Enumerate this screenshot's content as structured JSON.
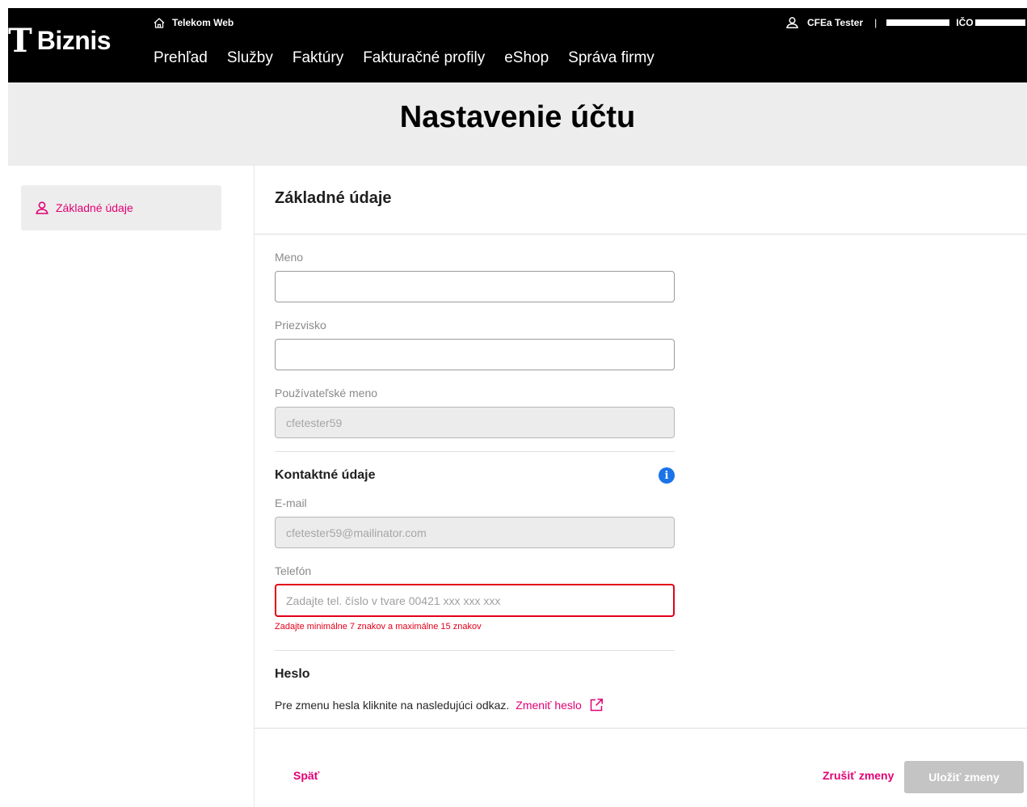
{
  "header": {
    "logo_mark": "T",
    "logo_text": "Biznis",
    "home_label": "Telekom Web",
    "nav": [
      {
        "label": "Prehľad"
      },
      {
        "label": "Služby"
      },
      {
        "label": "Faktúry"
      },
      {
        "label": "Fakturačné profily"
      },
      {
        "label": "eShop"
      },
      {
        "label": "Správa firmy"
      }
    ],
    "user_name": "CFEa Tester",
    "separator": "|",
    "ico_label": "IČO"
  },
  "page_title": "Nastavenie účtu",
  "sidebar": {
    "items": [
      {
        "label": "Základné údaje",
        "icon": "user-icon",
        "active": true
      }
    ]
  },
  "form": {
    "section_title": "Základné údaje",
    "first_name": {
      "label": "Meno",
      "value": ""
    },
    "last_name": {
      "label": "Priezvisko",
      "value": ""
    },
    "username": {
      "label": "Používateľské meno",
      "value": "cfetester59"
    },
    "contact_title": "Kontaktné údaje",
    "email": {
      "label": "E-mail",
      "value": "cfetester59@mailinator.com"
    },
    "phone": {
      "label": "Telefón",
      "placeholder": "Zadajte tel. číslo v tvare 00421 xxx xxx xxx",
      "error": "Zadajte minimálne 7 znakov a maximálne 15 znakov"
    },
    "password_title": "Heslo",
    "password_text": "Pre zmenu hesla kliknite na nasledujúci odkaz.",
    "password_link": "Zmeniť heslo"
  },
  "actions": {
    "back": "Späť",
    "cancel": "Zrušiť zmeny",
    "save": "Uložiť zmeny"
  },
  "colors": {
    "brand_magenta": "#e20074",
    "error_red": "#e2001a",
    "info_blue": "#1a73e8"
  }
}
